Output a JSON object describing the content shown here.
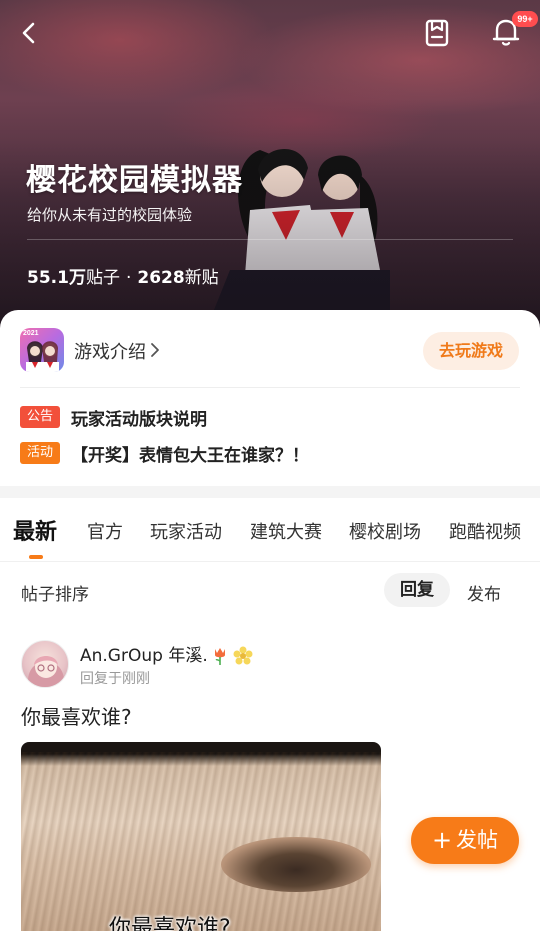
{
  "header": {
    "notification_badge": "99+",
    "icons": {
      "back": "chevron-left-icon",
      "save": "bookmark-save-icon",
      "notifications": "bell-icon"
    }
  },
  "hero": {
    "title": "樱花校园模拟器",
    "subtitle": "给你从未有过的校园体验",
    "stats": {
      "posts_count": "55.1万",
      "posts_unit": "贴子",
      "separator": "·",
      "new_count": "2628",
      "new_unit": "新贴"
    }
  },
  "game_card": {
    "icon_year": "2021",
    "intro_label": "游戏介绍",
    "play_label": "去玩游戏",
    "notices": [
      {
        "tag": "公告",
        "tag_color": "#f2503a",
        "text": "玩家活动版块说明"
      },
      {
        "tag": "活动",
        "tag_color": "#f77b18",
        "text": "【开奖】表情包大王在谁家？！"
      }
    ]
  },
  "tabs": {
    "active_index": 0,
    "items": [
      {
        "label": "最新"
      },
      {
        "label": "官方"
      },
      {
        "label": "玩家活动"
      },
      {
        "label": "建筑大赛"
      },
      {
        "label": "樱校剧场"
      },
      {
        "label": "跑酷视频"
      }
    ]
  },
  "sort": {
    "label": "帖子排序",
    "options": [
      {
        "label": "回复",
        "selected": true
      },
      {
        "label": "发布",
        "selected": false
      }
    ]
  },
  "posts": [
    {
      "author": "An.GrOup 年溪.",
      "time": "回复于刚刚",
      "title": "你最喜欢谁?",
      "image_caption": "你最喜欢谁?"
    }
  ],
  "fab": {
    "label": "发帖"
  },
  "colors": {
    "accent": "#f77b18",
    "badge": "#ff4d4f",
    "notice_red": "#f2503a"
  }
}
